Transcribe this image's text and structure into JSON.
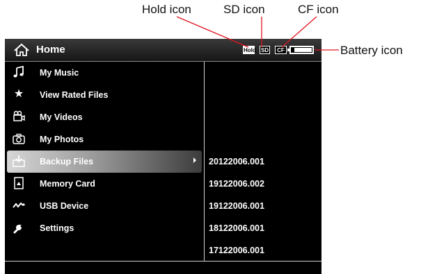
{
  "callouts": {
    "hold": "Hold icon",
    "sd": "SD icon",
    "cf": "CF icon",
    "battery": "Battery icon"
  },
  "header": {
    "title": "Home",
    "icon": "home-icon",
    "hold_badge": "Hold",
    "sd_badge": "SD",
    "cf_badge": "CF",
    "battery_level": 0.85
  },
  "menu": {
    "items": [
      {
        "label": "My Music",
        "icon": "music-note-icon"
      },
      {
        "label": "View Rated Files",
        "icon": "star-icon"
      },
      {
        "label": "My Videos",
        "icon": "video-camera-icon"
      },
      {
        "label": "My Photos",
        "icon": "camera-icon"
      },
      {
        "label": "Backup Files",
        "icon": "backup-icon",
        "selected": true
      },
      {
        "label": "Memory Card",
        "icon": "memory-card-icon"
      },
      {
        "label": "USB Device",
        "icon": "usb-icon"
      },
      {
        "label": "Settings",
        "icon": "wrench-icon"
      }
    ]
  },
  "files": [
    "20122006.001",
    "19122006.002",
    "19122006.001",
    "18122006.001",
    "17122006.001"
  ],
  "colors": {
    "screen_bg": "#000000",
    "text": "#ffffff",
    "callout_line": "#e0141e"
  }
}
